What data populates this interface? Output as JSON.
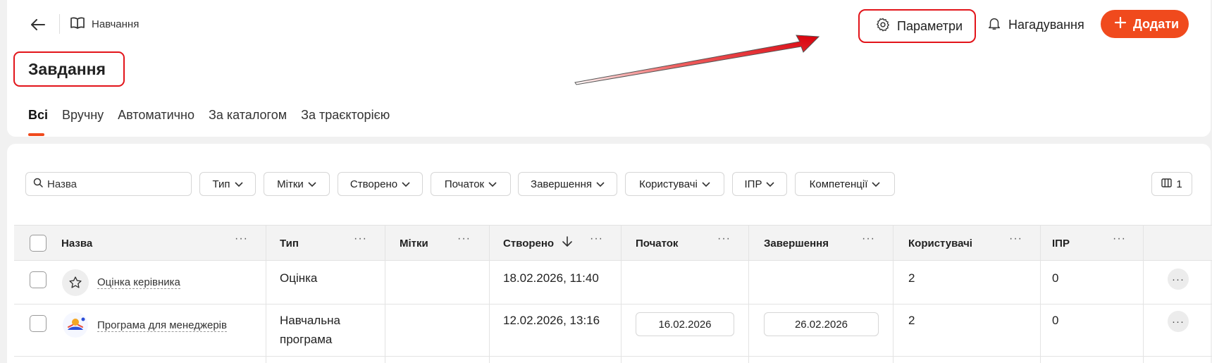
{
  "header": {
    "breadcrumb": "Навчання",
    "title": "Завдання",
    "params_label": "Параметри",
    "reminders_label": "Нагадування",
    "add_label": "Додати"
  },
  "tabs": [
    "Всі",
    "Вручну",
    "Автоматично",
    "За каталогом",
    "За траєкторією"
  ],
  "filters": {
    "search_placeholder": "Назва",
    "items": [
      "Тип",
      "Мітки",
      "Створено",
      "Початок",
      "Завершення",
      "Користувачі",
      "ІПР",
      "Компетенції"
    ],
    "columns_count": "1"
  },
  "table": {
    "headers": [
      "Назва",
      "Тип",
      "Мітки",
      "Створено",
      "Початок",
      "Завершення",
      "Користувачі",
      "ІПР"
    ],
    "rows": [
      {
        "name": "Оцінка керівника",
        "type": "Оцінка",
        "tags": "",
        "created": "18.02.2026, 11:40",
        "start": "",
        "end": "",
        "users": "2",
        "ipr": "0"
      },
      {
        "name": "Програма для менеджерів",
        "type_line1": "Навчальна",
        "type_line2": "програма",
        "tags": "",
        "created": "12.02.2026, 13:16",
        "start": "16.02.2026",
        "end": "26.02.2026",
        "users": "2",
        "ipr": "0"
      }
    ]
  },
  "colors": {
    "accent": "#f04a1d",
    "highlight": "#e2141a"
  },
  "icons": [
    "back-arrow-icon",
    "book-icon",
    "gear-icon",
    "bell-icon",
    "plus-icon",
    "search-icon",
    "chevron-down-icon",
    "columns-icon",
    "sort-down-icon",
    "star-icon",
    "more-icon"
  ]
}
